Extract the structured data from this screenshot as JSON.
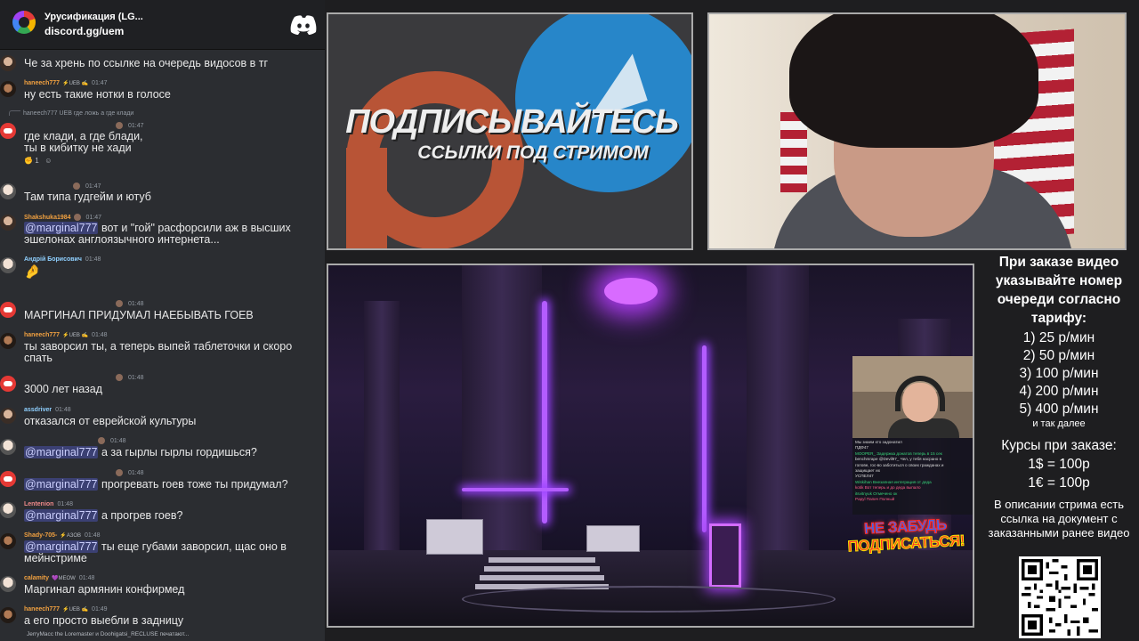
{
  "header": {
    "server_name": "Урусификация (LG...",
    "invite": "discord.gg/uem"
  },
  "chat": {
    "messages": [
      {
        "text": "Че за хрень по ссылке на очередь видосов в тг"
      },
      {
        "nick": "haneech777",
        "badge": "⚡UEB ✍",
        "time": "01:47",
        "text": "ну есть такие нотки в голосе"
      },
      {
        "reply": "haneech777 UEB где ложь а где клади",
        "time": "01:47",
        "text1": "где клади, а где блади,",
        "text2": "ты в кибитку не хади",
        "reaction": "1"
      },
      {
        "time": "01:47",
        "text": "Там типа гудгейм и ютуб"
      },
      {
        "nick": "Shakshuka1984",
        "time": "01:47",
        "text1": "вот и \"гой\" расфорсили аж в высших",
        "text2": "эшелонах англоязычного интернета...",
        "mention": "@marginal777"
      },
      {
        "nick": "Андрій Борисович",
        "time": "01:48",
        "text": "🤌"
      },
      {
        "time": "01:48",
        "text": "МАРГИНАЛ ПРИДУМАЛ НАЕБЫВАТЬ ГОЕВ"
      },
      {
        "nick": "haneech777",
        "badge": "⚡UEB ✍",
        "time": "01:48",
        "text1": "ты заворсил ты, а теперь выпей таблеточки и скоро",
        "text2": "спать"
      },
      {
        "time": "01:48",
        "text": "3000 лет назад"
      },
      {
        "nick": "assdriver",
        "time": "01:48",
        "text": "отказался от еврейской культуры"
      },
      {
        "time": "01:48",
        "mention": "@marginal777",
        "text": "а за гырлы гырлы гордишься?"
      },
      {
        "time": "01:48",
        "mention": "@marginal777",
        "text": "прогревать гоев тоже ты придумал?"
      },
      {
        "nick": "Lentenion",
        "time": "01:48",
        "mention": "@marginal777",
        "text": "а прогрев гоев?"
      },
      {
        "nick": "Shady-705-",
        "badge": "⚡АЗОВ",
        "time": "01:48",
        "mention": "@marginal777",
        "text1": "ты еще губами заворсил, щас оно в",
        "text2": "мейнстриме"
      },
      {
        "nick": "calamity",
        "badge": "💜MEOW",
        "time": "01:48",
        "text": "Маргинал армянин конфирмед"
      },
      {
        "nick": "haneech777",
        "badge": "⚡UEB ✍",
        "time": "01:49",
        "text": "а его просто выебли в задницу"
      }
    ],
    "typing": "JerryMacc the Loremaster и Doohigatsi_RECLUSE печатают..."
  },
  "promo": {
    "title": "ПОДПИСЫВАЙТЕСЬ",
    "subtitle": "ССЫЛКИ ПОД СТРИМОМ"
  },
  "game": {
    "pip_chat": [
      "Мы знаем кто задонатил",
      "ПДФ47",
      "MOOPER_ Задержка донатов теперь в 15 сек",
      "benchmrape @Devil97_ Чел, у тебя насрано в",
      "голове, гос-во заботиться о своих гражданах и",
      "защищает их",
      "УСПЕЛ47",
      "Wiskihan Внезапная интеграция от деда",
      "kotik Вот теперь и до деда выпало",
      "itsvitnyuk Отмечено ок",
      "Papyl Папич Полный"
    ],
    "sticker_line1": "НЕ ЗАБУДЬ",
    "sticker_line2": "ПОДПИСАТЬСЯ!"
  },
  "info": {
    "heading": "При заказе видео указывайте номер очереди согласно тарифу:",
    "tariffs": [
      "1) 25 р/мин",
      "2) 50 р/мин",
      "3) 100 р/мин",
      "4) 200 р/мин",
      "5) 400 р/мин"
    ],
    "etc": "и так далее",
    "currency_heading": "Курсы при заказе:",
    "currency": [
      "1$ = 100р",
      "1€ = 100р"
    ],
    "description": "В описании стрима есть ссылка на документ с заказанными ранее видео"
  },
  "colors": {
    "chat_bg": "#2b2d31",
    "mention_bg": "#5865f2",
    "nick_orange": "#f0a040",
    "telegram_blue": "#2786c9",
    "patreon_orange": "#b85436",
    "neon_purple": "#b35cff"
  }
}
